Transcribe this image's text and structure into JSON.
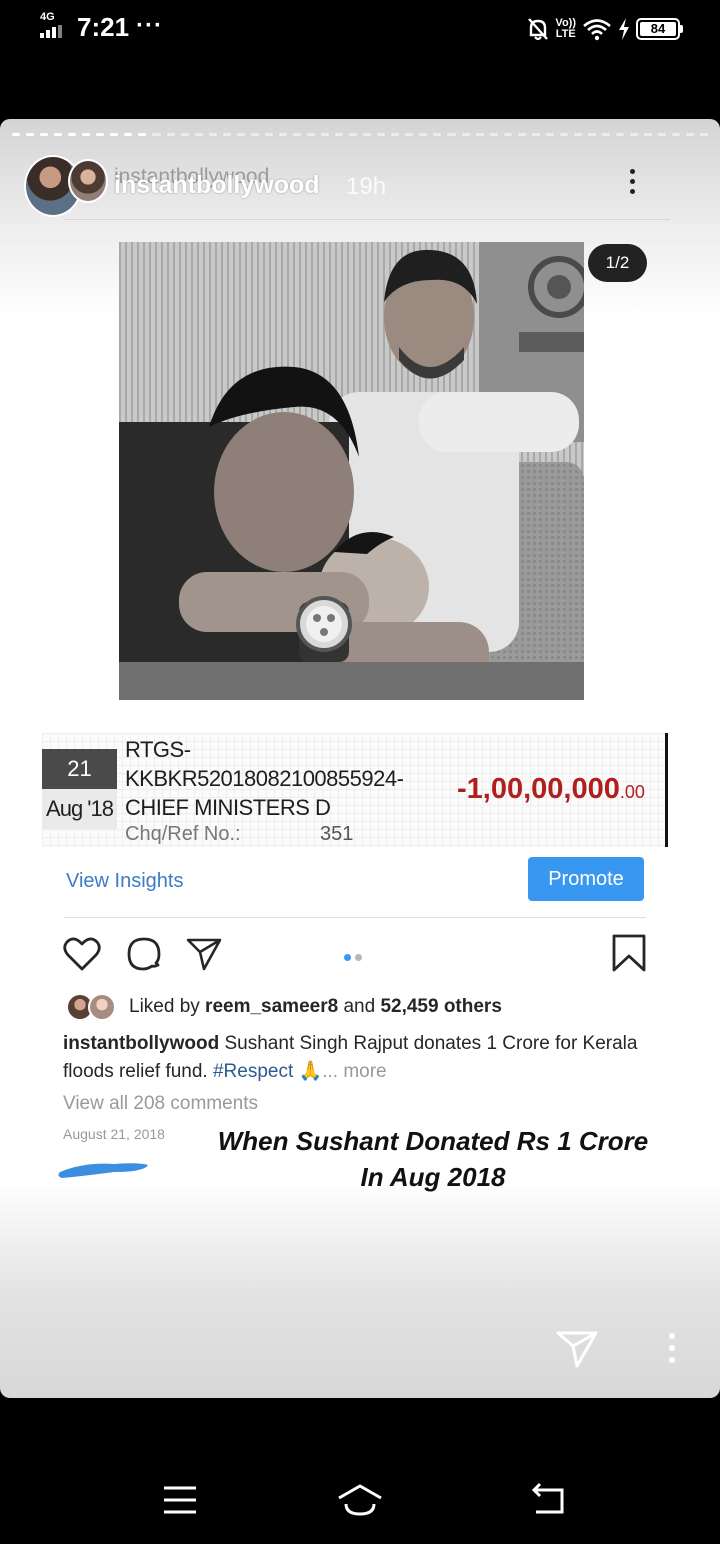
{
  "status_bar": {
    "network": "4G",
    "time": "7:21",
    "more": "···",
    "volte_top": "Vo))",
    "volte_bottom": "LTE",
    "battery": "84"
  },
  "story": {
    "progress_segments": 50,
    "progress_done": 10,
    "username": "instantbollywood",
    "username_ghost": "instantbollywood",
    "time_ago": "19h",
    "page_indicator": "1/2"
  },
  "bank_entry": {
    "day": "21",
    "month": "Aug '18",
    "line1": "RTGS-",
    "line2": "KKBKR52018082100855924-",
    "line3": "CHIEF MINISTERS D",
    "ref_label": "Chq/Ref No.:",
    "ref_number": "351",
    "amount_main": "-1,00,00,000",
    "amount_decimals": ".00"
  },
  "post": {
    "view_insights": "View Insights",
    "promote_label": "Promote",
    "liked_prefix": "Liked by ",
    "liked_user": "reem_sameer8",
    "liked_and": " and ",
    "liked_others": "52,459 others",
    "caption_user": "instantbollywood",
    "caption_text": " Sushant Singh Rajput donates 1 Crore for Kerala floods relief fund. ",
    "caption_tag": "#Respect",
    "caption_emoji": " 🙏",
    "caption_more": "... more",
    "view_comments": "View all 208 comments",
    "date": "August 21, 2018"
  },
  "overlay": {
    "line1": "When Sushant Donated Rs 1 Crore",
    "line2": "In Aug 2018"
  },
  "colors": {
    "accent_blue": "#3897f0",
    "amount_red": "#b11e1e",
    "link_blue": "#3b7cc6"
  }
}
